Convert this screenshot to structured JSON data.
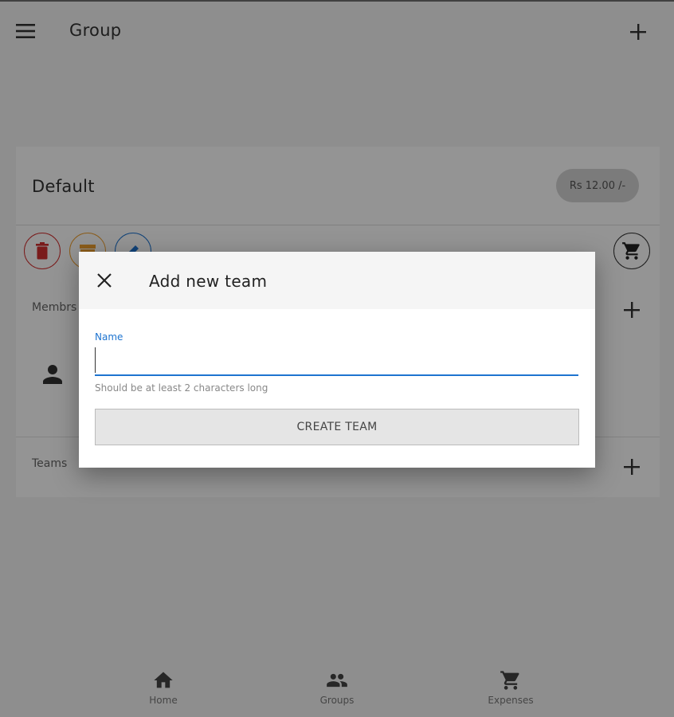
{
  "header": {
    "title": "Group"
  },
  "group_card": {
    "title": "Default",
    "amount": "Rs 12.00 /-",
    "members_label": "Membrs",
    "teams_label": "Teams"
  },
  "dialog": {
    "title": "Add new team",
    "name_label": "Name",
    "name_value": "",
    "hint": "Should be at least 2 characters long",
    "create_button": "CREATE TEAM"
  },
  "bottom_nav": [
    {
      "label": "Home",
      "icon": "home-icon"
    },
    {
      "label": "Groups",
      "icon": "groups-icon"
    },
    {
      "label": "Expenses",
      "icon": "cart-icon"
    }
  ],
  "colors": {
    "accent": "#1e74d0",
    "danger": "#d32f2f",
    "warning": "#f0a030",
    "scrim": "rgba(0,0,0,0.42)"
  }
}
